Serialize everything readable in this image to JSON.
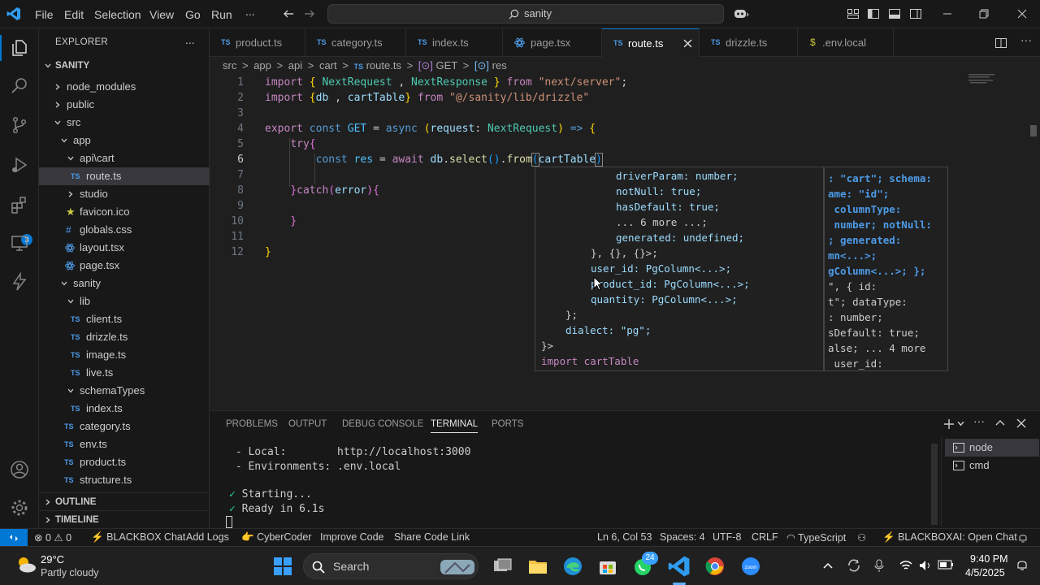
{
  "titlebar": {
    "menu": [
      "File",
      "Edit",
      "Selection",
      "View",
      "Go",
      "Run",
      "..."
    ],
    "search_text": "sanity"
  },
  "activity": {
    "extensions_badge": "3"
  },
  "sidebar": {
    "title": "EXPLORER",
    "more": "...",
    "root": "SANITY",
    "items": [
      {
        "label": "node_modules",
        "type": "folder-closed"
      },
      {
        "label": "public",
        "type": "folder-closed"
      },
      {
        "label": "src",
        "type": "folder-open"
      },
      {
        "label": "app",
        "type": "folder-open"
      },
      {
        "label": "api\\cart",
        "type": "folder-open"
      },
      {
        "label": "route.ts",
        "type": "ts"
      },
      {
        "label": "studio",
        "type": "folder-closed"
      },
      {
        "label": "favicon.ico",
        "type": "ico"
      },
      {
        "label": "globals.css",
        "type": "css"
      },
      {
        "label": "layout.tsx",
        "type": "tsx"
      },
      {
        "label": "page.tsx",
        "type": "tsx"
      },
      {
        "label": "sanity",
        "type": "folder-open"
      },
      {
        "label": "lib",
        "type": "folder-open"
      },
      {
        "label": "client.ts",
        "type": "ts"
      },
      {
        "label": "drizzle.ts",
        "type": "ts"
      },
      {
        "label": "image.ts",
        "type": "ts"
      },
      {
        "label": "live.ts",
        "type": "ts"
      },
      {
        "label": "schemaTypes",
        "type": "folder-open"
      },
      {
        "label": "index.ts",
        "type": "ts"
      },
      {
        "label": "category.ts",
        "type": "ts"
      },
      {
        "label": "env.ts",
        "type": "ts"
      },
      {
        "label": "product.ts",
        "type": "ts"
      },
      {
        "label": "structure.ts",
        "type": "ts"
      }
    ],
    "outline": "OUTLINE",
    "timeline": "TIMELINE"
  },
  "tabs": [
    {
      "label": "product.ts",
      "icon": "TS"
    },
    {
      "label": "category.ts",
      "icon": "TS"
    },
    {
      "label": "index.ts",
      "icon": "TS"
    },
    {
      "label": "page.tsx",
      "icon": "tsx"
    },
    {
      "label": "route.ts",
      "icon": "TS",
      "active": true
    },
    {
      "label": "drizzle.ts",
      "icon": "TS"
    },
    {
      "label": ".env.local",
      "icon": "$"
    }
  ],
  "breadcrumb": {
    "parts": [
      "src",
      "app",
      "api",
      "cart"
    ],
    "file": "route.ts",
    "fn1": "GET",
    "fn2": "res",
    "sep": ">",
    "ts": "TS"
  },
  "editor": {
    "line_numbers": [
      "1",
      "2",
      "3",
      "4",
      "5",
      "6",
      "7",
      "8",
      "9",
      "10",
      "11",
      "12"
    ],
    "cursor_line": "6"
  },
  "hover": {
    "lines": [
      "driverParam: number;",
      "notNull: true;",
      "hasDefault: true;",
      "... 6 more ...;",
      "generated: undefined;",
      "}, {}, {}>;",
      "user_id: PgColumn<...>;",
      "product_id: PgColumn<...>;",
      "quantity: PgColumn<...>;",
      "};",
      "dialect: \"pg\";",
      "}>",
      "import cartTable"
    ],
    "side_lines": [
      ": \"cart\"; schema:",
      "ame: \"id\";",
      " columnType:",
      " number; notNull:",
      "; generated:",
      "mn<...>;",
      "gColumn<...>; };",
      "\", { id:",
      "t\"; dataType:",
      ": number;",
      "sDefault: true;",
      "alse; ... 4 more",
      " user_id:"
    ]
  },
  "panel": {
    "tabs": [
      "PROBLEMS",
      "OUTPUT",
      "DEBUG CONSOLE",
      "TERMINAL",
      "PORTS"
    ],
    "active_tab": "TERMINAL",
    "terminal_lines": [
      " - Local:        http://localhost:3000",
      " - Environments: .env.local",
      "",
      "Starting...",
      "Ready in 6.1s"
    ],
    "check": "✓",
    "terminals": [
      "node",
      "cmd"
    ]
  },
  "statusbar": {
    "errors": "0",
    "warnings": "0",
    "blackbox": "BLACKBOX Chat",
    "addlogs": "Add Logs",
    "cyber": "CyberCoder",
    "improve": "Improve Code",
    "share": "Share Code Link",
    "position": "Ln 6, Col 53",
    "spaces": "Spaces: 4",
    "encoding": "UTF-8",
    "eol": "CRLF",
    "lang": "TypeScript",
    "blackboxai": "BLACKBOXAI: Open Chat"
  },
  "taskbar": {
    "temp": "29°C",
    "weather": "Partly cloudy",
    "search": "Search",
    "time": "9:40 PM",
    "date": "4/5/2025",
    "whatsapp_badge": "24"
  }
}
